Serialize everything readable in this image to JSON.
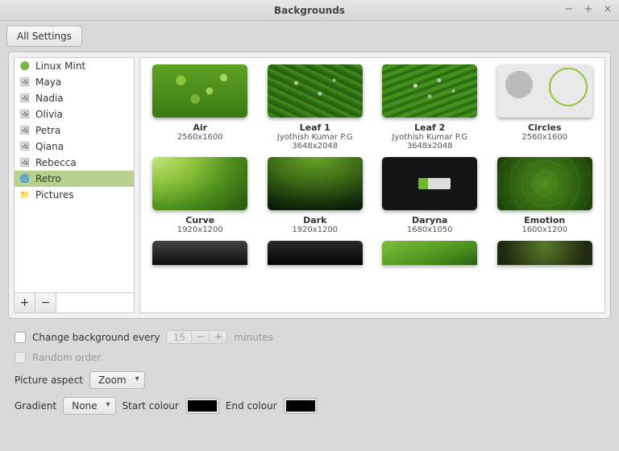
{
  "window": {
    "title": "Backgrounds"
  },
  "toolbar": {
    "all_settings": "All Settings"
  },
  "sidebar": {
    "items": [
      {
        "label": "Linux Mint",
        "icon": "🟢"
      },
      {
        "label": "Maya",
        "icon": "🖼"
      },
      {
        "label": "Nadia",
        "icon": "🖼"
      },
      {
        "label": "Olivia",
        "icon": "🖼"
      },
      {
        "label": "Petra",
        "icon": "🖼"
      },
      {
        "label": "Qiana",
        "icon": "🖼"
      },
      {
        "label": "Rebecca",
        "icon": "🖼"
      },
      {
        "label": "Retro",
        "icon": "🌀"
      },
      {
        "label": "Pictures",
        "icon": "📁"
      }
    ],
    "selected_index": 7,
    "add": "+",
    "remove": "−"
  },
  "wallpapers": [
    {
      "name": "Air",
      "author": "",
      "resolution": "2560x1600"
    },
    {
      "name": "Leaf 1",
      "author": "Jyothish Kumar P.G",
      "resolution": "3648x2048"
    },
    {
      "name": "Leaf 2",
      "author": "Jyothish Kumar P.G",
      "resolution": "3648x2048"
    },
    {
      "name": "Circles",
      "author": "",
      "resolution": "2560x1600"
    },
    {
      "name": "Curve",
      "author": "",
      "resolution": "1920x1200"
    },
    {
      "name": "Dark",
      "author": "",
      "resolution": "1920x1200"
    },
    {
      "name": "Daryna",
      "author": "",
      "resolution": "1680x1050"
    },
    {
      "name": "Emotion",
      "author": "",
      "resolution": "1600x1200"
    }
  ],
  "settings": {
    "change_every_label": "Change background every",
    "change_every_value": "15",
    "change_every_unit": "minutes",
    "random_order_label": "Random order",
    "picture_aspect_label": "Picture aspect",
    "picture_aspect_value": "Zoom",
    "gradient_label": "Gradient",
    "gradient_value": "None",
    "start_colour_label": "Start colour",
    "end_colour_label": "End colour",
    "start_colour": "#000000",
    "end_colour": "#000000"
  }
}
